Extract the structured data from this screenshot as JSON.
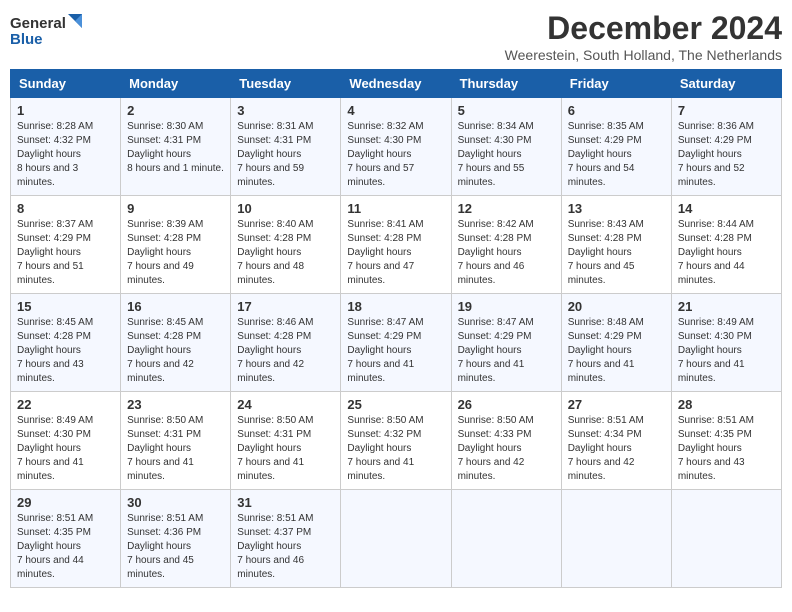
{
  "logo": {
    "line1": "General",
    "line2": "Blue"
  },
  "title": "December 2024",
  "subtitle": "Weerestein, South Holland, The Netherlands",
  "days_of_week": [
    "Sunday",
    "Monday",
    "Tuesday",
    "Wednesday",
    "Thursday",
    "Friday",
    "Saturday"
  ],
  "weeks": [
    [
      {
        "day": "1",
        "sunrise": "8:28 AM",
        "sunset": "4:32 PM",
        "daylight": "8 hours and 3 minutes."
      },
      {
        "day": "2",
        "sunrise": "8:30 AM",
        "sunset": "4:31 PM",
        "daylight": "8 hours and 1 minute."
      },
      {
        "day": "3",
        "sunrise": "8:31 AM",
        "sunset": "4:31 PM",
        "daylight": "7 hours and 59 minutes."
      },
      {
        "day": "4",
        "sunrise": "8:32 AM",
        "sunset": "4:30 PM",
        "daylight": "7 hours and 57 minutes."
      },
      {
        "day": "5",
        "sunrise": "8:34 AM",
        "sunset": "4:30 PM",
        "daylight": "7 hours and 55 minutes."
      },
      {
        "day": "6",
        "sunrise": "8:35 AM",
        "sunset": "4:29 PM",
        "daylight": "7 hours and 54 minutes."
      },
      {
        "day": "7",
        "sunrise": "8:36 AM",
        "sunset": "4:29 PM",
        "daylight": "7 hours and 52 minutes."
      }
    ],
    [
      {
        "day": "8",
        "sunrise": "8:37 AM",
        "sunset": "4:29 PM",
        "daylight": "7 hours and 51 minutes."
      },
      {
        "day": "9",
        "sunrise": "8:39 AM",
        "sunset": "4:28 PM",
        "daylight": "7 hours and 49 minutes."
      },
      {
        "day": "10",
        "sunrise": "8:40 AM",
        "sunset": "4:28 PM",
        "daylight": "7 hours and 48 minutes."
      },
      {
        "day": "11",
        "sunrise": "8:41 AM",
        "sunset": "4:28 PM",
        "daylight": "7 hours and 47 minutes."
      },
      {
        "day": "12",
        "sunrise": "8:42 AM",
        "sunset": "4:28 PM",
        "daylight": "7 hours and 46 minutes."
      },
      {
        "day": "13",
        "sunrise": "8:43 AM",
        "sunset": "4:28 PM",
        "daylight": "7 hours and 45 minutes."
      },
      {
        "day": "14",
        "sunrise": "8:44 AM",
        "sunset": "4:28 PM",
        "daylight": "7 hours and 44 minutes."
      }
    ],
    [
      {
        "day": "15",
        "sunrise": "8:45 AM",
        "sunset": "4:28 PM",
        "daylight": "7 hours and 43 minutes."
      },
      {
        "day": "16",
        "sunrise": "8:45 AM",
        "sunset": "4:28 PM",
        "daylight": "7 hours and 42 minutes."
      },
      {
        "day": "17",
        "sunrise": "8:46 AM",
        "sunset": "4:28 PM",
        "daylight": "7 hours and 42 minutes."
      },
      {
        "day": "18",
        "sunrise": "8:47 AM",
        "sunset": "4:29 PM",
        "daylight": "7 hours and 41 minutes."
      },
      {
        "day": "19",
        "sunrise": "8:47 AM",
        "sunset": "4:29 PM",
        "daylight": "7 hours and 41 minutes."
      },
      {
        "day": "20",
        "sunrise": "8:48 AM",
        "sunset": "4:29 PM",
        "daylight": "7 hours and 41 minutes."
      },
      {
        "day": "21",
        "sunrise": "8:49 AM",
        "sunset": "4:30 PM",
        "daylight": "7 hours and 41 minutes."
      }
    ],
    [
      {
        "day": "22",
        "sunrise": "8:49 AM",
        "sunset": "4:30 PM",
        "daylight": "7 hours and 41 minutes."
      },
      {
        "day": "23",
        "sunrise": "8:50 AM",
        "sunset": "4:31 PM",
        "daylight": "7 hours and 41 minutes."
      },
      {
        "day": "24",
        "sunrise": "8:50 AM",
        "sunset": "4:31 PM",
        "daylight": "7 hours and 41 minutes."
      },
      {
        "day": "25",
        "sunrise": "8:50 AM",
        "sunset": "4:32 PM",
        "daylight": "7 hours and 41 minutes."
      },
      {
        "day": "26",
        "sunrise": "8:50 AM",
        "sunset": "4:33 PM",
        "daylight": "7 hours and 42 minutes."
      },
      {
        "day": "27",
        "sunrise": "8:51 AM",
        "sunset": "4:34 PM",
        "daylight": "7 hours and 42 minutes."
      },
      {
        "day": "28",
        "sunrise": "8:51 AM",
        "sunset": "4:35 PM",
        "daylight": "7 hours and 43 minutes."
      }
    ],
    [
      {
        "day": "29",
        "sunrise": "8:51 AM",
        "sunset": "4:35 PM",
        "daylight": "7 hours and 44 minutes."
      },
      {
        "day": "30",
        "sunrise": "8:51 AM",
        "sunset": "4:36 PM",
        "daylight": "7 hours and 45 minutes."
      },
      {
        "day": "31",
        "sunrise": "8:51 AM",
        "sunset": "4:37 PM",
        "daylight": "7 hours and 46 minutes."
      },
      null,
      null,
      null,
      null
    ]
  ],
  "labels": {
    "sunrise": "Sunrise:",
    "sunset": "Sunset:",
    "daylight": "Daylight hours"
  }
}
